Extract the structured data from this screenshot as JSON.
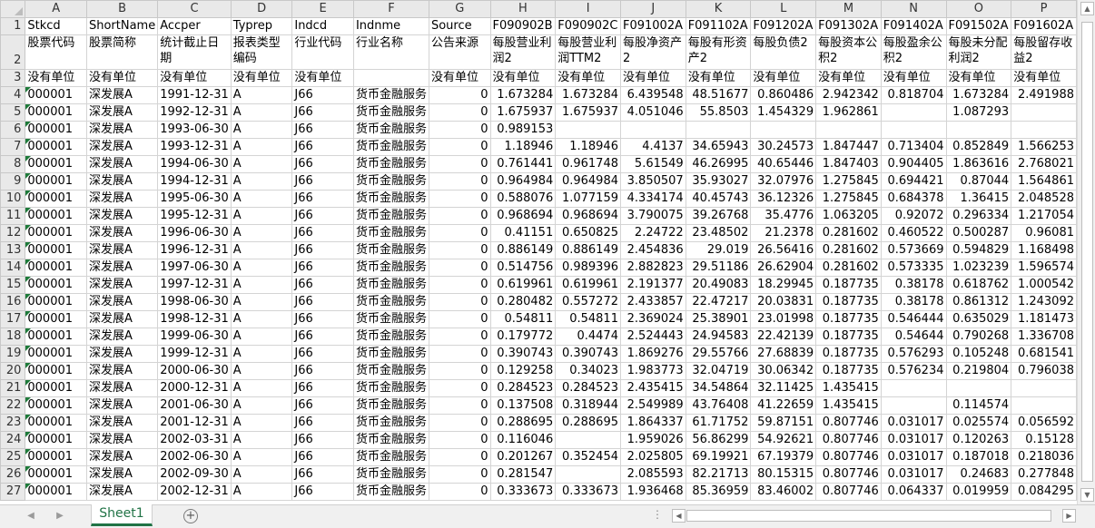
{
  "columns": [
    "A",
    "B",
    "C",
    "D",
    "E",
    "F",
    "G",
    "H",
    "I",
    "J",
    "K",
    "L",
    "M",
    "N",
    "O",
    "P"
  ],
  "header_row1": [
    "Stkcd",
    "ShortName",
    "Accper",
    "Typrep",
    "Indcd",
    "Indnme",
    "Source",
    "F090902B",
    "F090902C",
    "F091002A",
    "F091102A",
    "F091202A",
    "F091302A",
    "F091402A",
    "F091502A",
    "F091602A"
  ],
  "header_row2": [
    "股票代码",
    "股票简称",
    "统计截止日期",
    "报表类型编码",
    "行业代码",
    "行业名称",
    "公告来源",
    "每股营业利润2",
    "每股营业利润TTM2",
    "每股净资产2",
    "每股有形资产2",
    "每股负债2",
    "每股资本公积2",
    "每股盈余公积2",
    "每股未分配利润2",
    "每股留存收益2"
  ],
  "unit_row": [
    "没有单位",
    "没有单位",
    "没有单位",
    "没有单位",
    "没有单位",
    "",
    "没有单位",
    "没有单位",
    "没有单位",
    "没有单位",
    "没有单位",
    "没有单位",
    "没有单位",
    "没有单位",
    "没有单位",
    "没有单位"
  ],
  "data_rows": [
    {
      "num": "4",
      "cells": [
        "000001",
        "深发展A",
        "1991-12-31",
        "A",
        "J66",
        "货币金融服务",
        "0",
        "1.673284",
        "1.673284",
        "6.439548",
        "48.51677",
        "0.860486",
        "2.942342",
        "0.818704",
        "1.673284",
        "2.491988"
      ]
    },
    {
      "num": "5",
      "cells": [
        "000001",
        "深发展A",
        "1992-12-31",
        "A",
        "J66",
        "货币金融服务",
        "0",
        "1.675937",
        "1.675937",
        "4.051046",
        "55.8503",
        "1.454329",
        "1.962861",
        "",
        "1.087293",
        ""
      ]
    },
    {
      "num": "6",
      "cells": [
        "000001",
        "深发展A",
        "1993-06-30",
        "A",
        "J66",
        "货币金融服务",
        "0",
        "0.989153",
        "",
        "",
        "",
        "",
        "",
        "",
        "",
        ""
      ]
    },
    {
      "num": "7",
      "cells": [
        "000001",
        "深发展A",
        "1993-12-31",
        "A",
        "J66",
        "货币金融服务",
        "0",
        "1.18946",
        "1.18946",
        "4.4137",
        "34.65943",
        "30.24573",
        "1.847447",
        "0.713404",
        "0.852849",
        "1.566253"
      ]
    },
    {
      "num": "8",
      "cells": [
        "000001",
        "深发展A",
        "1994-06-30",
        "A",
        "J66",
        "货币金融服务",
        "0",
        "0.761441",
        "0.961748",
        "5.61549",
        "46.26995",
        "40.65446",
        "1.847403",
        "0.904405",
        "1.863616",
        "2.768021"
      ]
    },
    {
      "num": "9",
      "cells": [
        "000001",
        "深发展A",
        "1994-12-31",
        "A",
        "J66",
        "货币金融服务",
        "0",
        "0.964984",
        "0.964984",
        "3.850507",
        "35.93027",
        "32.07976",
        "1.275845",
        "0.694421",
        "0.87044",
        "1.564861"
      ]
    },
    {
      "num": "10",
      "cells": [
        "000001",
        "深发展A",
        "1995-06-30",
        "A",
        "J66",
        "货币金融服务",
        "0",
        "0.588076",
        "1.077159",
        "4.334174",
        "40.45743",
        "36.12326",
        "1.275845",
        "0.684378",
        "1.36415",
        "2.048528"
      ]
    },
    {
      "num": "11",
      "cells": [
        "000001",
        "深发展A",
        "1995-12-31",
        "A",
        "J66",
        "货币金融服务",
        "0",
        "0.968694",
        "0.968694",
        "3.790075",
        "39.26768",
        "35.4776",
        "1.063205",
        "0.92072",
        "0.296334",
        "1.217054"
      ]
    },
    {
      "num": "12",
      "cells": [
        "000001",
        "深发展A",
        "1996-06-30",
        "A",
        "J66",
        "货币金融服务",
        "0",
        "0.41151",
        "0.650825",
        "2.24722",
        "23.48502",
        "21.2378",
        "0.281602",
        "0.460522",
        "0.500287",
        "0.96081"
      ]
    },
    {
      "num": "13",
      "cells": [
        "000001",
        "深发展A",
        "1996-12-31",
        "A",
        "J66",
        "货币金融服务",
        "0",
        "0.886149",
        "0.886149",
        "2.454836",
        "29.019",
        "26.56416",
        "0.281602",
        "0.573669",
        "0.594829",
        "1.168498"
      ]
    },
    {
      "num": "14",
      "cells": [
        "000001",
        "深发展A",
        "1997-06-30",
        "A",
        "J66",
        "货币金融服务",
        "0",
        "0.514756",
        "0.989396",
        "2.882823",
        "29.51186",
        "26.62904",
        "0.281602",
        "0.573335",
        "1.023239",
        "1.596574"
      ]
    },
    {
      "num": "15",
      "cells": [
        "000001",
        "深发展A",
        "1997-12-31",
        "A",
        "J66",
        "货币金融服务",
        "0",
        "0.619961",
        "0.619961",
        "2.191377",
        "20.49083",
        "18.29945",
        "0.187735",
        "0.38178",
        "0.618762",
        "1.000542"
      ]
    },
    {
      "num": "16",
      "cells": [
        "000001",
        "深发展A",
        "1998-06-30",
        "A",
        "J66",
        "货币金融服务",
        "0",
        "0.280482",
        "0.557272",
        "2.433857",
        "22.47217",
        "20.03831",
        "0.187735",
        "0.38178",
        "0.861312",
        "1.243092"
      ]
    },
    {
      "num": "17",
      "cells": [
        "000001",
        "深发展A",
        "1998-12-31",
        "A",
        "J66",
        "货币金融服务",
        "0",
        "0.54811",
        "0.54811",
        "2.369024",
        "25.38901",
        "23.01998",
        "0.187735",
        "0.546444",
        "0.635029",
        "1.181473"
      ]
    },
    {
      "num": "18",
      "cells": [
        "000001",
        "深发展A",
        "1999-06-30",
        "A",
        "J66",
        "货币金融服务",
        "0",
        "0.179772",
        "0.4474",
        "2.524443",
        "24.94583",
        "22.42139",
        "0.187735",
        "0.54644",
        "0.790268",
        "1.336708"
      ]
    },
    {
      "num": "19",
      "cells": [
        "000001",
        "深发展A",
        "1999-12-31",
        "A",
        "J66",
        "货币金融服务",
        "0",
        "0.390743",
        "0.390743",
        "1.869276",
        "29.55766",
        "27.68839",
        "0.187735",
        "0.576293",
        "0.105248",
        "0.681541"
      ]
    },
    {
      "num": "20",
      "cells": [
        "000001",
        "深发展A",
        "2000-06-30",
        "A",
        "J66",
        "货币金融服务",
        "0",
        "0.129258",
        "0.34023",
        "1.983773",
        "32.04719",
        "30.06342",
        "0.187735",
        "0.576234",
        "0.219804",
        "0.796038"
      ]
    },
    {
      "num": "21",
      "cells": [
        "000001",
        "深发展A",
        "2000-12-31",
        "A",
        "J66",
        "货币金融服务",
        "0",
        "0.284523",
        "0.284523",
        "2.435415",
        "34.54864",
        "32.11425",
        "1.435415",
        "",
        "",
        ""
      ]
    },
    {
      "num": "22",
      "cells": [
        "000001",
        "深发展A",
        "2001-06-30",
        "A",
        "J66",
        "货币金融服务",
        "0",
        "0.137508",
        "0.318944",
        "2.549989",
        "43.76408",
        "41.22659",
        "1.435415",
        "",
        "0.114574",
        ""
      ]
    },
    {
      "num": "23",
      "cells": [
        "000001",
        "深发展A",
        "2001-12-31",
        "A",
        "J66",
        "货币金融服务",
        "0",
        "0.288695",
        "0.288695",
        "1.864337",
        "61.71752",
        "59.87151",
        "0.807746",
        "0.031017",
        "0.025574",
        "0.056592"
      ]
    },
    {
      "num": "24",
      "cells": [
        "000001",
        "深发展A",
        "2002-03-31",
        "A",
        "J66",
        "货币金融服务",
        "0",
        "0.116046",
        "",
        "1.959026",
        "56.86299",
        "54.92621",
        "0.807746",
        "0.031017",
        "0.120263",
        "0.15128"
      ]
    },
    {
      "num": "25",
      "cells": [
        "000001",
        "深发展A",
        "2002-06-30",
        "A",
        "J66",
        "货币金融服务",
        "0",
        "0.201267",
        "0.352454",
        "2.025805",
        "69.19921",
        "67.19379",
        "0.807746",
        "0.031017",
        "0.187018",
        "0.218036"
      ]
    },
    {
      "num": "26",
      "cells": [
        "000001",
        "深发展A",
        "2002-09-30",
        "A",
        "J66",
        "货币金融服务",
        "0",
        "0.281547",
        "",
        "2.085593",
        "82.21713",
        "80.15315",
        "0.807746",
        "0.031017",
        "0.24683",
        "0.277848"
      ]
    },
    {
      "num": "27",
      "cells": [
        "000001",
        "深发展A",
        "2002-12-31",
        "A",
        "J66",
        "货币金融服务",
        "0",
        "0.333673",
        "0.333673",
        "1.936468",
        "85.36959",
        "83.46002",
        "0.807746",
        "0.064337",
        "0.019959",
        "0.084295"
      ]
    }
  ],
  "sheet_tab": "Sheet1",
  "add_sheet": "⊕",
  "colors": {
    "accent": "#217346",
    "header_bg": "#e9e9e9",
    "gridline": "#d4d4d4"
  }
}
